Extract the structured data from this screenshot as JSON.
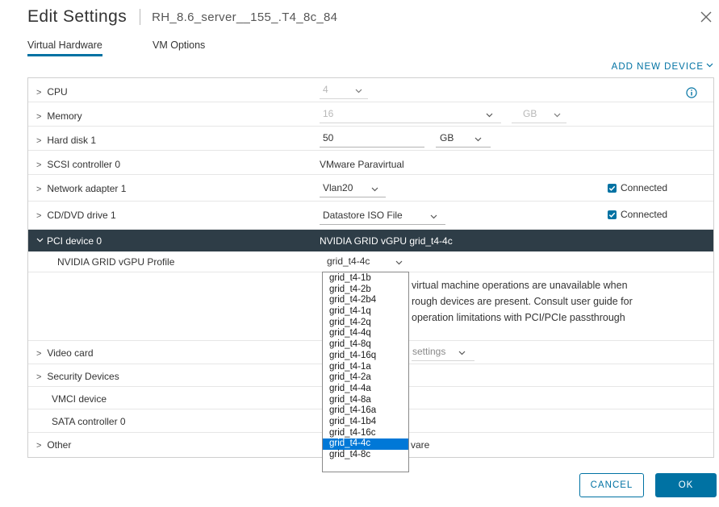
{
  "dialog": {
    "title": "Edit Settings",
    "vm_name": "RH_8.6_server__155_.T4_8c_84"
  },
  "tabs": [
    {
      "label": "Virtual Hardware",
      "active": true
    },
    {
      "label": "VM Options",
      "active": false
    }
  ],
  "add_new_device": "ADD NEW DEVICE",
  "rows": {
    "cpu": {
      "label": "CPU",
      "value": "4"
    },
    "memory": {
      "label": "Memory",
      "value": "16",
      "unit": "GB"
    },
    "hard_disk": {
      "label": "Hard disk 1",
      "value": "50",
      "unit": "GB"
    },
    "scsi": {
      "label": "SCSI controller 0",
      "value": "VMware Paravirtual"
    },
    "network": {
      "label": "Network adapter 1",
      "value": "Vlan20",
      "connected_label": "Connected",
      "connected": true
    },
    "cdrom": {
      "label": "CD/DVD drive 1",
      "value": "Datastore ISO File",
      "connected_label": "Connected",
      "connected": true
    },
    "pci": {
      "label": "PCI device 0",
      "value": "NVIDIA GRID vGPU grid_t4-4c"
    },
    "vgpu_profile": {
      "label": "NVIDIA GRID vGPU Profile",
      "value": "grid_t4-4c"
    },
    "note_lines": [
      "virtual machine operations are unavailable when",
      "rough devices are present. Consult user guide for",
      "operation limitations with PCI/PCIe passthrough"
    ],
    "video_card": {
      "label": "Video card",
      "value": "settings"
    },
    "security": {
      "label": "Security Devices"
    },
    "vmci": {
      "label": "VMCI device"
    },
    "sata": {
      "label": "SATA controller 0"
    },
    "other": {
      "label": "Other",
      "value": "vare"
    }
  },
  "profile_options": [
    "grid_t4-1b",
    "grid_t4-2b",
    "grid_t4-2b4",
    "grid_t4-1q",
    "grid_t4-2q",
    "grid_t4-4q",
    "grid_t4-8q",
    "grid_t4-16q",
    "grid_t4-1a",
    "grid_t4-2a",
    "grid_t4-4a",
    "grid_t4-8a",
    "grid_t4-16a",
    "grid_t4-1b4",
    "grid_t4-16c",
    "grid_t4-4c",
    "grid_t4-8c"
  ],
  "selected_profile": "grid_t4-4c",
  "buttons": {
    "cancel": "CANCEL",
    "ok": "OK"
  },
  "colors": {
    "accent": "#0072a3",
    "header_dark": "#2e3d47",
    "listbox_selected": "#0078d7"
  },
  "icons": {
    "close": "close-icon",
    "info": "info-icon",
    "expand": "chevron-right-icon",
    "collapse": "chevron-down-icon"
  }
}
